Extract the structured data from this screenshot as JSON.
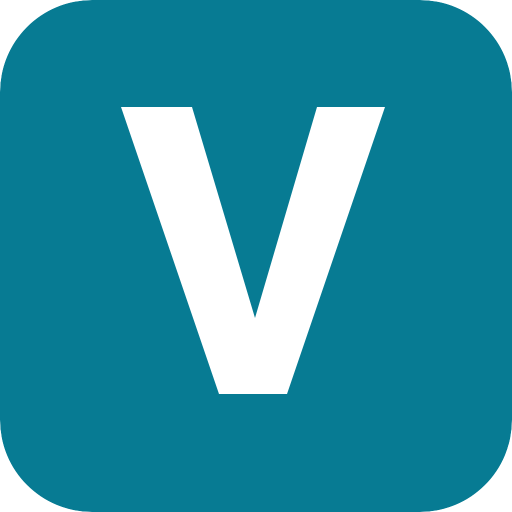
{
  "icon": {
    "name": "v-logo-icon",
    "letter": "V",
    "colors": {
      "background": "#077B93",
      "glyph": "#FFFFFF"
    }
  }
}
